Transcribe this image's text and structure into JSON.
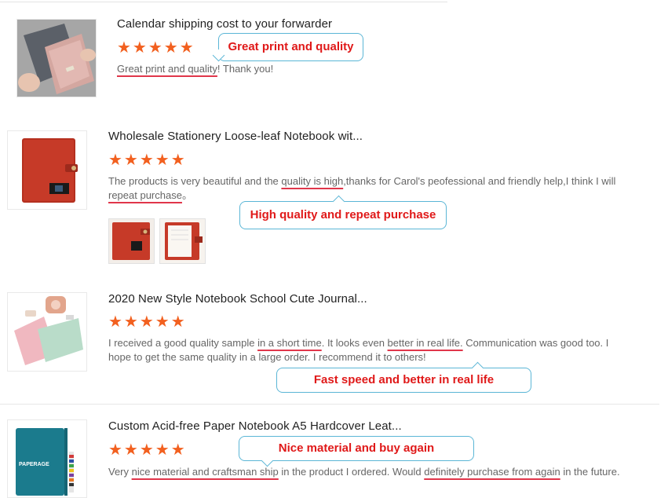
{
  "reviews": [
    {
      "title": "Calendar shipping cost to your forwarder",
      "stars": "★★★★★",
      "text_parts": [
        "Great print and quality",
        "! Thank you!"
      ],
      "callout": "Great print and quality"
    },
    {
      "title": "Wholesale Stationery Loose-leaf Notebook wit...",
      "stars": "★★★★★",
      "text_parts": [
        "The products is very beautiful and the ",
        "quality is high",
        ",thanks for Carol's peofessional and friendly help,I think I will ",
        "repeat purchase",
        "。"
      ],
      "callout": "High quality and repeat purchase"
    },
    {
      "title": "2020 New Style Notebook School Cute Journal...",
      "stars": "★★★★★",
      "text_parts": [
        "I received a good quality sample ",
        "in a short time",
        ". It looks even ",
        "better in real life.",
        " Communication was good too. I hope to get the same quality in a large order. I recommend it to others!"
      ],
      "callout": "Fast speed and better in real life"
    },
    {
      "title": "Custom Acid-free Paper Notebook A5 Hardcover Leat...",
      "stars": "★★★★★",
      "text_parts": [
        "Very ",
        "nice material and craftsman ship",
        " in the product I ordered. Would ",
        "definitely purchase from again",
        " in the future."
      ],
      "callout": "Nice material and buy again"
    }
  ],
  "cover_text": "PAPERAGE",
  "colors": {
    "star": "#f2601f",
    "callout_text": "#e01919",
    "callout_border": "#5bb6d6",
    "underline": "#e0364a"
  }
}
